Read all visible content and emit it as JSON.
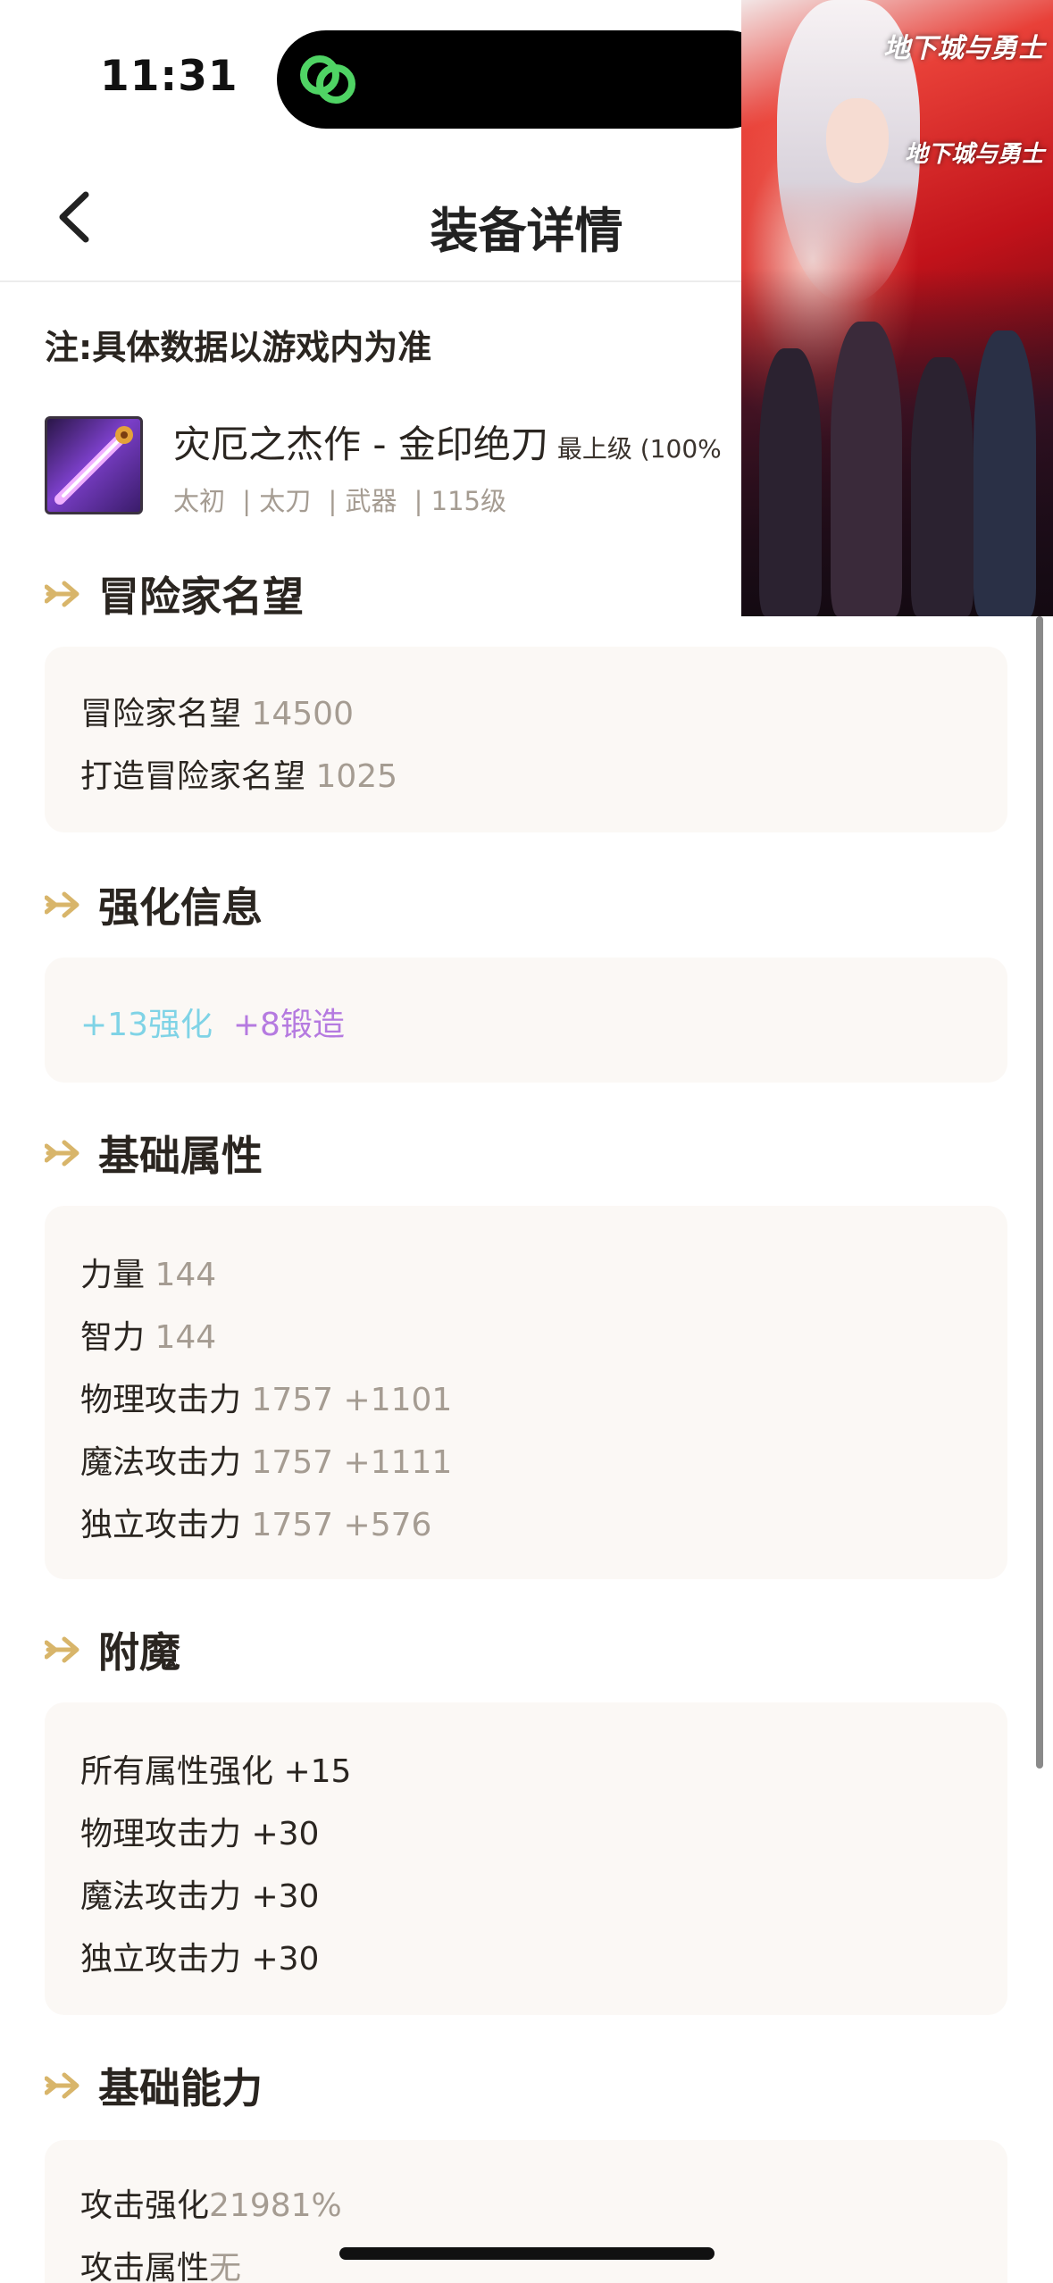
{
  "status": {
    "time": "11:31"
  },
  "header": {
    "title": "装备详情"
  },
  "note": "注:具体数据以游戏内为准",
  "item": {
    "name": "灾厄之杰作 - 金印绝刀",
    "level_tag": "最上级 (100%",
    "tags": [
      "太初",
      "| 太刀",
      "| 武器",
      "| 115级"
    ]
  },
  "pip": {
    "logo_1": "地下城与勇士",
    "logo_2": "地下城与勇士"
  },
  "sections": {
    "reputation": {
      "title": "冒险家名望",
      "rows": [
        {
          "label": "冒险家名望",
          "value": "14500"
        },
        {
          "label": "打造冒险家名望",
          "value": "1025"
        }
      ]
    },
    "enhance": {
      "title": "强化信息",
      "reinforce": "+13强化",
      "forge": "+8锻造",
      "reinforce_color": "#7fd3e6",
      "forge_color": "#b57ae0"
    },
    "base_attr": {
      "title": "基础属性",
      "rows": [
        {
          "label": "力量",
          "value": "144"
        },
        {
          "label": "智力",
          "value": "144"
        },
        {
          "label": "物理攻击力",
          "value": "1757 +1101"
        },
        {
          "label": "魔法攻击力",
          "value": "1757 +1111"
        },
        {
          "label": "独立攻击力",
          "value": "1757 +576"
        }
      ]
    },
    "enchant": {
      "title": "附魔",
      "rows": [
        "所有属性强化 +15",
        "物理攻击力 +30",
        "魔法攻击力 +30",
        "独立攻击力 +30"
      ]
    },
    "base_ability": {
      "title": "基础能力",
      "rows": [
        {
          "label": "攻击强化",
          "value": "21981%"
        },
        {
          "label": "攻击属性",
          "value": "无"
        }
      ]
    }
  },
  "colors": {
    "accent_arrow": "#d8b56a",
    "card_bg": "#fbf8f5",
    "muted": "#a59c92"
  }
}
